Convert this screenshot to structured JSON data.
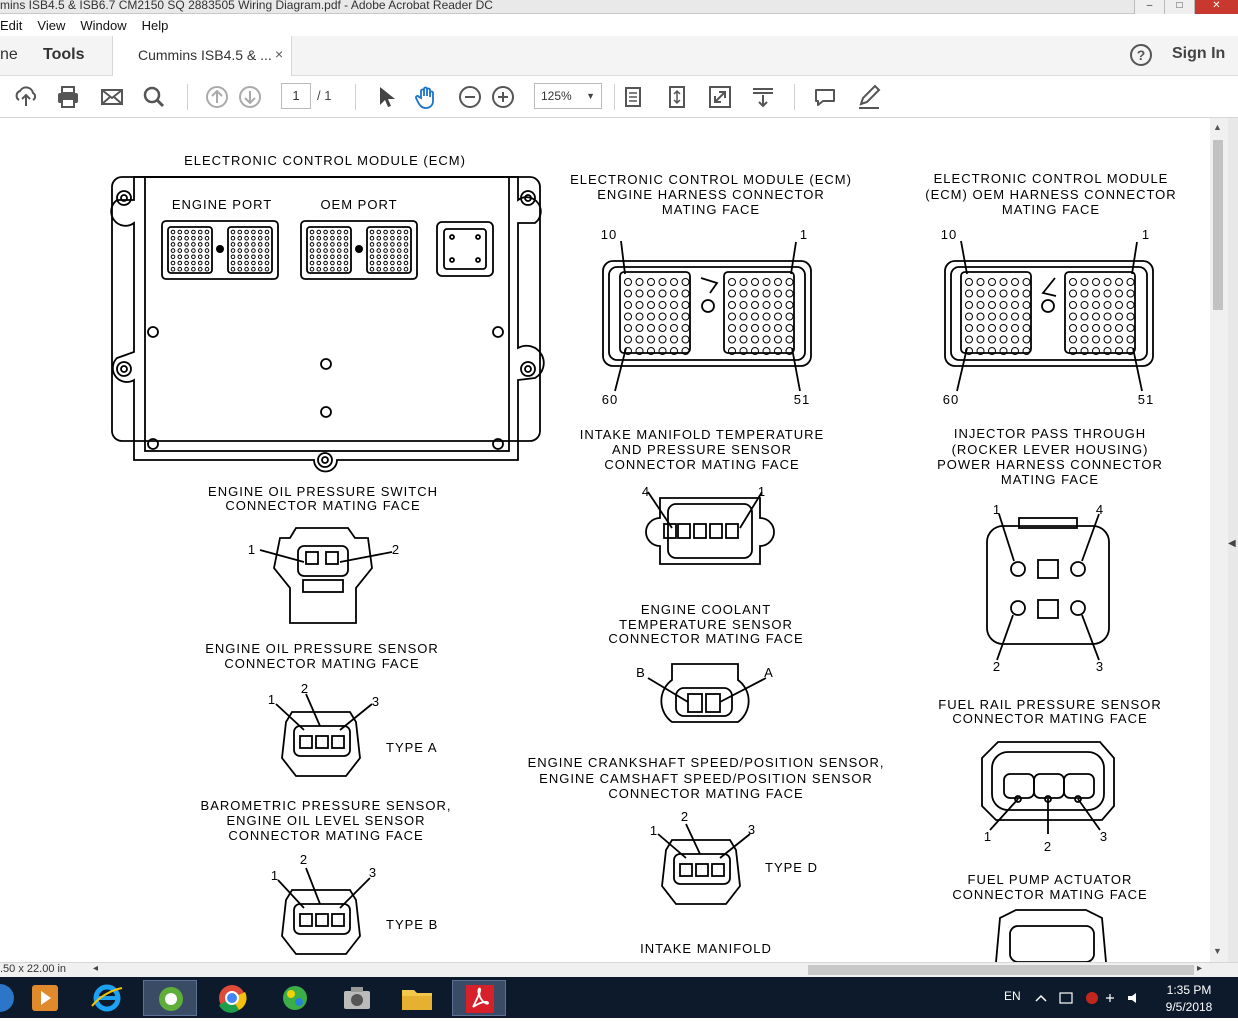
{
  "window": {
    "title": "mins ISB4.5 & ISB6.7 CM2150 SQ 2883505 Wiring Diagram.pdf - Adobe Acrobat Reader DC",
    "controls": [
      "–",
      "□",
      "✕"
    ]
  },
  "menu": [
    "Edit",
    "View",
    "Window",
    "Help"
  ],
  "tabs": {
    "home": "ne",
    "tools": "Tools",
    "document": "Cummins ISB4.5 & ...",
    "close": "×"
  },
  "header": {
    "help": "?",
    "signin": "Sign In"
  },
  "toolbar": {
    "page_current": "1",
    "page_total": "/ 1",
    "zoom": "125%",
    "icons": [
      "upload-icon",
      "print-icon",
      "email-icon",
      "search-icon",
      "page-up-icon",
      "page-down-icon",
      "select-cursor-icon",
      "hand-tool-icon",
      "zoom-out-icon",
      "zoom-in-icon",
      "fit-page-icon",
      "scroll-mode-icon",
      "full-screen-icon",
      "read-mode-icon",
      "comment-icon",
      "pen-icon"
    ]
  },
  "diagram": {
    "ecm_title": "ELECTRONIC CONTROL MODULE (ECM)",
    "engine_port": "ENGINE PORT",
    "oem_port": "OEM PORT",
    "engine_harness": [
      "ELECTRONIC CONTROL MODULE (ECM)",
      "ENGINE HARNESS CONNECTOR",
      "MATING FACE"
    ],
    "oem_harness": [
      "ELECTRONIC CONTROL MODULE",
      "(ECM) OEM HARNESS CONNECTOR",
      "MATING FACE"
    ],
    "pin_labels": {
      "p10": "10",
      "p1": "1",
      "p60": "60",
      "p51": "51"
    },
    "oil_press_switch": [
      "ENGINE OIL PRESSURE SWITCH",
      "CONNECTOR MATING FACE"
    ],
    "intake_temp_press": [
      "INTAKE MANIFOLD TEMPERATURE",
      "AND PRESSURE SENSOR",
      "CONNECTOR MATING FACE"
    ],
    "injector_pass": [
      "INJECTOR PASS THROUGH",
      "(ROCKER LEVER HOUSING)",
      "POWER HARNESS CONNECTOR",
      "MATING FACE"
    ],
    "oil_press_sensor": [
      "ENGINE OIL PRESSURE SENSOR",
      "CONNECTOR MATING FACE"
    ],
    "coolant_temp": [
      "ENGINE COOLANT",
      "TEMPERATURE SENSOR",
      "CONNECTOR MATING FACE"
    ],
    "fuel_rail": [
      "FUEL RAIL PRESSURE SENSOR",
      "CONNECTOR MATING FACE"
    ],
    "crank_cam": [
      "ENGINE CRANKSHAFT SPEED/POSITION SENSOR,",
      "ENGINE CAMSHAFT SPEED/POSITION SENSOR",
      "CONNECTOR MATING FACE"
    ],
    "baro": [
      "BAROMETRIC PRESSURE SENSOR,",
      "ENGINE OIL LEVEL SENSOR",
      "CONNECTOR MATING FACE"
    ],
    "fuel_pump": [
      "FUEL PUMP ACTUATOR",
      "CONNECTOR MATING FACE"
    ],
    "intake_bottom": "INTAKE MANIFOLD",
    "type_a": "TYPE A",
    "type_b": "TYPE B",
    "type_d": "TYPE D",
    "n1": "1",
    "n2": "2",
    "n3": "3",
    "n4": "4",
    "na": "A",
    "nb": "B"
  },
  "status": {
    "page_size": ".50 x 22.00 in"
  },
  "taskbar": {
    "apps": [
      "windows-start-icon",
      "media-player-icon",
      "internet-explorer-icon",
      "greenshot-icon",
      "chrome-icon",
      "parrot-app-icon",
      "camera-app-icon",
      "file-explorer-icon",
      "acrobat-icon"
    ],
    "language": "EN",
    "time": "1:35 PM",
    "date": "9/5/2018"
  }
}
